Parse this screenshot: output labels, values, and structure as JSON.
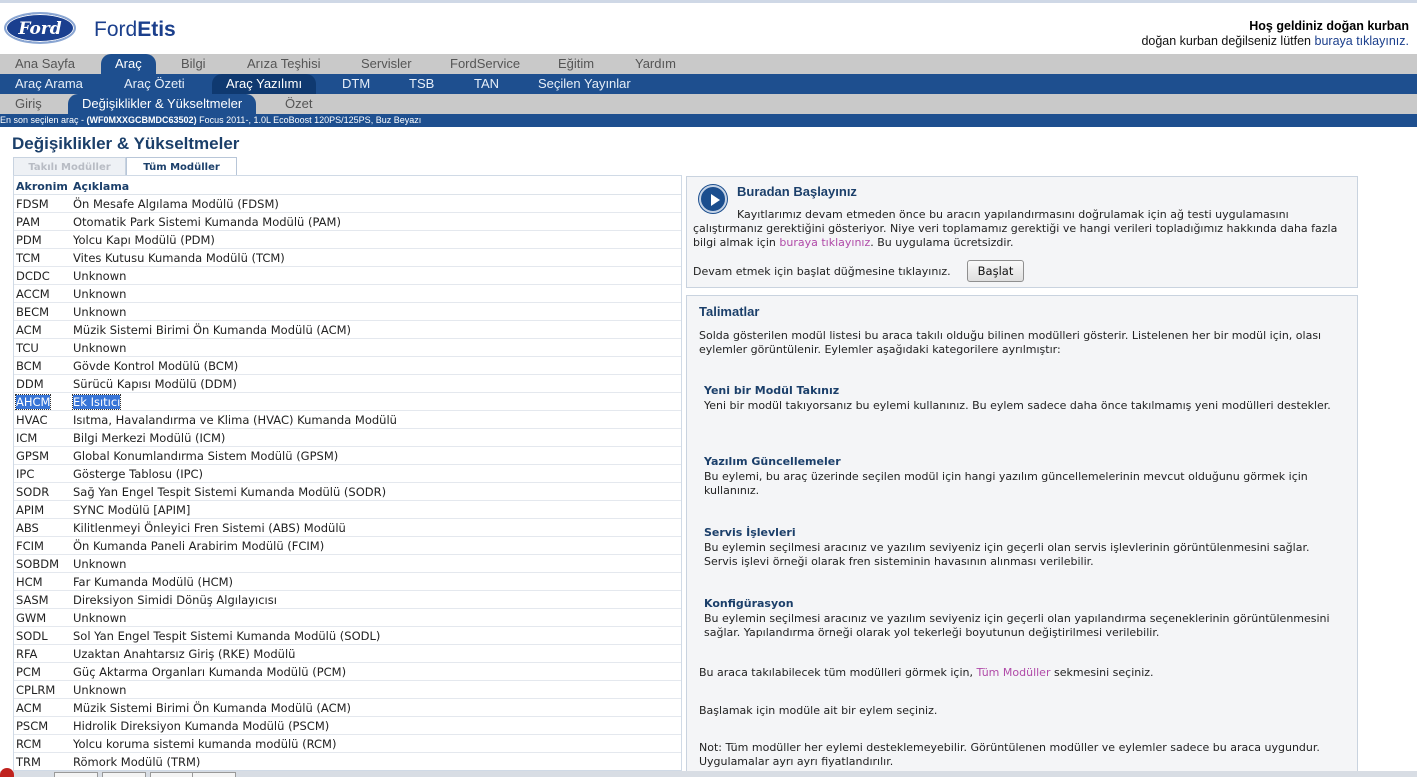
{
  "header": {
    "logo_text": "Ford",
    "brand_light": "Ford",
    "brand_bold": "Etis",
    "welcome_title": "Hoş geldiniz doğan kurban",
    "welcome_sub": "doğan kurban değilseniz lütfen",
    "welcome_link": "buraya tıklayınız."
  },
  "nav1": [
    {
      "label": "Ana Sayfa"
    },
    {
      "label": "Araç"
    },
    {
      "label": "Bilgi"
    },
    {
      "label": "Arıza Teşhisi"
    },
    {
      "label": "Servisler"
    },
    {
      "label": "FordService"
    },
    {
      "label": "Eğitim"
    },
    {
      "label": "Yardım"
    }
  ],
  "nav2": [
    {
      "label": "Araç Arama"
    },
    {
      "label": "Araç Özeti"
    },
    {
      "label": "Araç Yazılımı"
    },
    {
      "label": "DTM"
    },
    {
      "label": "TSB"
    },
    {
      "label": "TAN"
    },
    {
      "label": "Seçilen Yayınlar"
    }
  ],
  "nav3": [
    {
      "label": "Giriş"
    },
    {
      "label": "Değişiklikler & Yükseltmeler"
    },
    {
      "label": "Özet"
    }
  ],
  "vehicle_bar": {
    "prefix": "En son seçilen araç - ",
    "vin": "(WF0MXXGCBMDC63502)",
    "desc": " Focus 2011-, 1.0L EcoBoost 120PS/125PS, Buz Beyazı"
  },
  "page_title": "Değişiklikler & Yükseltmeler",
  "tabs": {
    "installed": "Takılı Modüller",
    "all": "Tüm Modüller"
  },
  "table": {
    "col_acronym": "Akronim",
    "col_desc": "Açıklama",
    "rows": [
      {
        "acr": "FDSM",
        "desc": "Ön Mesafe Algılama Modülü (FDSM)"
      },
      {
        "acr": "PAM",
        "desc": "Otomatik Park Sistemi Kumanda Modülü (PAM)"
      },
      {
        "acr": "PDM",
        "desc": "Yolcu Kapı Modülü (PDM)"
      },
      {
        "acr": "TCM",
        "desc": "Vites Kutusu Kumanda Modülü (TCM)"
      },
      {
        "acr": "DCDC",
        "desc": "Unknown"
      },
      {
        "acr": "ACCM",
        "desc": "Unknown"
      },
      {
        "acr": "BECM",
        "desc": "Unknown"
      },
      {
        "acr": "ACM",
        "desc": "Müzik Sistemi Birimi Ön Kumanda Modülü (ACM)"
      },
      {
        "acr": "TCU",
        "desc": "Unknown"
      },
      {
        "acr": "BCM",
        "desc": "Gövde Kontrol Modülü (BCM)"
      },
      {
        "acr": "DDM",
        "desc": "Sürücü Kapısı Modülü (DDM)"
      },
      {
        "acr": "AHCM",
        "desc": "Ek Isıtıcı"
      },
      {
        "acr": "HVAC",
        "desc": "Isıtma, Havalandırma ve Klima (HVAC) Kumanda Modülü"
      },
      {
        "acr": "ICM",
        "desc": "Bilgi Merkezi Modülü (ICM)"
      },
      {
        "acr": "GPSM",
        "desc": "Global Konumlandırma Sistem Modülü (GPSM)"
      },
      {
        "acr": "IPC",
        "desc": "Gösterge Tablosu (IPC)"
      },
      {
        "acr": "SODR",
        "desc": "Sağ Yan Engel Tespit Sistemi Kumanda Modülü (SODR)"
      },
      {
        "acr": "APIM",
        "desc": "SYNC Modülü [APIM]"
      },
      {
        "acr": "ABS",
        "desc": "Kilitlenmeyi Önleyici Fren Sistemi (ABS) Modülü"
      },
      {
        "acr": "FCIM",
        "desc": "Ön Kumanda Paneli Arabirim Modülü (FCIM)"
      },
      {
        "acr": "SOBDM",
        "desc": "Unknown"
      },
      {
        "acr": "HCM",
        "desc": "Far Kumanda Modülü (HCM)"
      },
      {
        "acr": "SASM",
        "desc": "Direksiyon Simidi Dönüş Algılayıcısı"
      },
      {
        "acr": "GWM",
        "desc": "Unknown"
      },
      {
        "acr": "SODL",
        "desc": "Sol Yan Engel Tespit Sistemi Kumanda Modülü (SODL)"
      },
      {
        "acr": "RFA",
        "desc": "Uzaktan Anahtarsız Giriş (RKE) Modülü"
      },
      {
        "acr": "PCM",
        "desc": "Güç Aktarma Organları Kumanda Modülü (PCM)"
      },
      {
        "acr": "CPLRM",
        "desc": "Unknown"
      },
      {
        "acr": "ACM",
        "desc": "Müzik Sistemi Birimi Ön Kumanda Modülü (ACM)"
      },
      {
        "acr": "PSCM",
        "desc": "Hidrolik Direksiyon Kumanda Modülü (PSCM)"
      },
      {
        "acr": "RCM",
        "desc": "Yolcu koruma sistemi kumanda modülü (RCM)"
      },
      {
        "acr": "TRM",
        "desc": "Römork Modülü (TRM)"
      }
    ]
  },
  "start": {
    "title": "Buradan Başlayınız",
    "text1": "Kayıtlarımız devam etmeden önce bu aracın yapılandırmasını doğrulamak için ağ testi uygulamasını çalıştırmanız gerektiğini gösteriyor. Niye veri toplamamız gerektiği ve hangi verileri topladığımız hakkında daha fazla bilgi almak için ",
    "link": "buraya tıklayınız",
    "text2": ". Bu uygulama ücretsizdir.",
    "prompt": "Devam etmek için başlat düğmesine tıklayınız.",
    "button": "Başlat"
  },
  "instructions": {
    "title": "Talimatlar",
    "intro": "Solda gösterilen modül listesi bu araca takılı olduğu bilinen modülleri gösterir. Listelenen her bir modül için, olası eylemler görüntülenir. Eylemler aşağıdaki kategorilere ayrılmıştır:",
    "s1_title": "Yeni bir Modül Takınız",
    "s1_text": "Yeni bir modül takıyorsanız bu eylemi kullanınız. Bu eylem sadece daha önce takılmamış yeni modülleri destekler.",
    "s2_title": "Yazılım Güncellemeler",
    "s2_text": "Bu eylemi, bu araç üzerinde seçilen modül için hangi yazılım güncellemelerinin mevcut olduğunu görmek için kullanınız.",
    "s3_title": "Servis İşlevleri",
    "s3_text": "Bu eylemin seçilmesi aracınız ve yazılım seviyeniz için geçerli olan servis işlevlerinin görüntülenmesini sağlar. Servis işlevi örneği olarak fren sisteminin havasının alınması verilebilir.",
    "s4_title": "Konfigürasyon",
    "s4_text": "Bu eylemin seçilmesi aracınız ve yazılım seviyeniz için geçerli olan yapılandırma seçeneklerinin görüntülenmesini sağlar. Yapılandırma örneği olarak yol tekerleği boyutunun değiştirilmesi verilebilir.",
    "all_pre": "Bu araca takılabilecek tüm modülleri görmek için, ",
    "all_link": "Tüm Modüller",
    "all_post": " sekmesini seçiniz.",
    "begin": "Başlamak için modüle ait bir eylem seçiniz.",
    "note": "Not: Tüm modüller her eylemi desteklemeyebilir. Görüntülenen modüller ve eylemler sadece bu araca uygundur. Uygulamalar ayrı ayrı fiyatlandırılır."
  },
  "colors": {
    "nav_blue": "#1e4f8f",
    "nav_grey": "#c9c9c9",
    "title_blue": "#1b3f6a",
    "link_purple": "#b04aa8",
    "selection": "#3875d7"
  }
}
